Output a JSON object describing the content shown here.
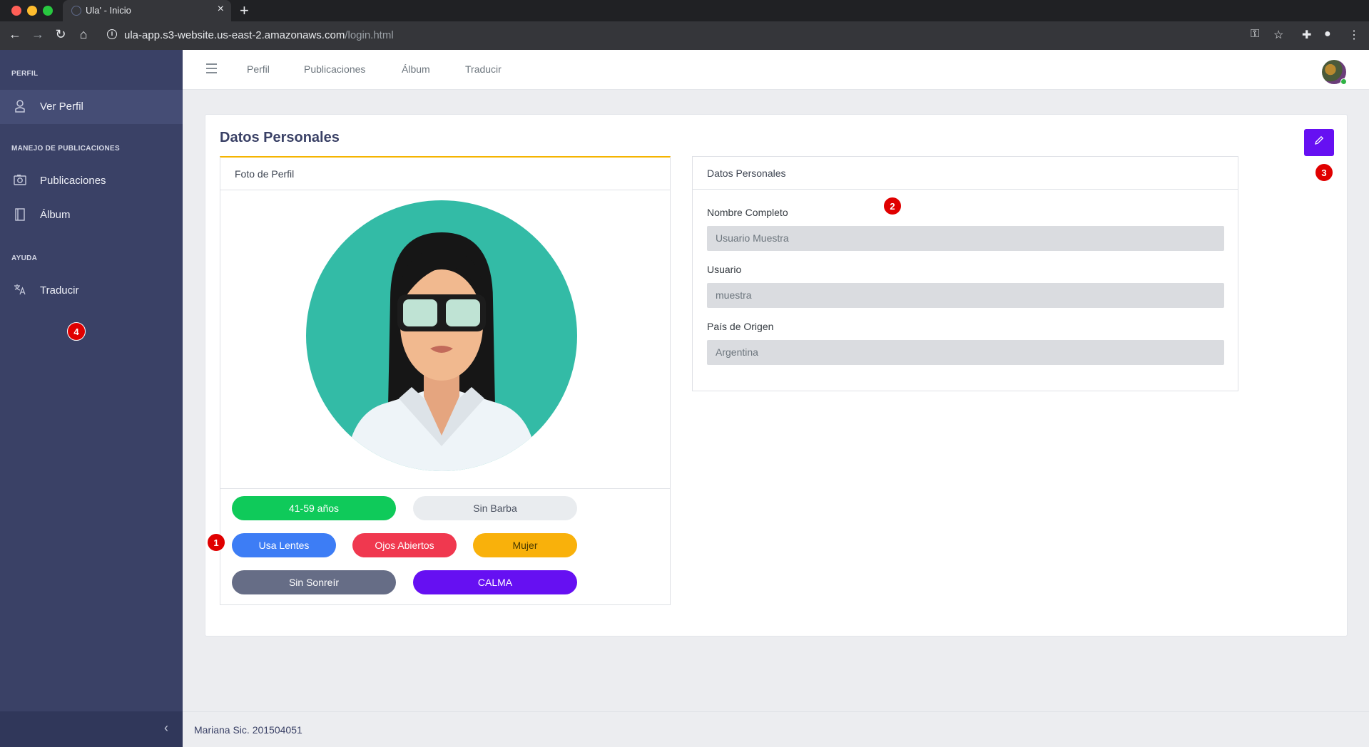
{
  "browser": {
    "tab_title": "Ula' - Inicio",
    "url_host": "ula-app.s3-website.us-east-2.amazonaws.com",
    "url_path": "/login.html"
  },
  "sidebar": {
    "sections": [
      "PERFIL",
      "MANEJO DE PUBLICACIONES",
      "AYUDA"
    ],
    "items": [
      {
        "label": "Ver Perfil",
        "icon": "user-icon"
      },
      {
        "label": "Publicaciones",
        "icon": "camera-icon"
      },
      {
        "label": "Álbum",
        "icon": "book-icon"
      },
      {
        "label": "Traducir",
        "icon": "translate-icon"
      }
    ]
  },
  "header": {
    "nav": [
      "Perfil",
      "Publicaciones",
      "Álbum",
      "Traducir"
    ]
  },
  "main": {
    "title": "Datos Personales",
    "photo_panel_title": "Foto de Perfil",
    "data_panel_title": "Datos Personales",
    "badges": [
      {
        "label": "41-59 años",
        "color": "#0fca5a"
      },
      {
        "label": "Sin Barba",
        "color": "#e9ecef"
      },
      {
        "label": "Usa Lentes",
        "color": "#3d7df5"
      },
      {
        "label": "Ojos Abiertos",
        "color": "#f0384f"
      },
      {
        "label": "Mujer",
        "color": "#f9b10b"
      },
      {
        "label": "Sin Sonreír",
        "color": "#666d86"
      },
      {
        "label": "CALMA",
        "color": "#6610f2"
      }
    ],
    "fields": [
      {
        "label": "Nombre Completo",
        "value": "Usuario Muestra"
      },
      {
        "label": "Usuario",
        "value": "muestra"
      },
      {
        "label": "País de Origen",
        "value": "Argentina"
      }
    ]
  },
  "markers": [
    "1",
    "2",
    "3",
    "4"
  ],
  "footer": {
    "text": "Mariana Sic. 201504051"
  }
}
